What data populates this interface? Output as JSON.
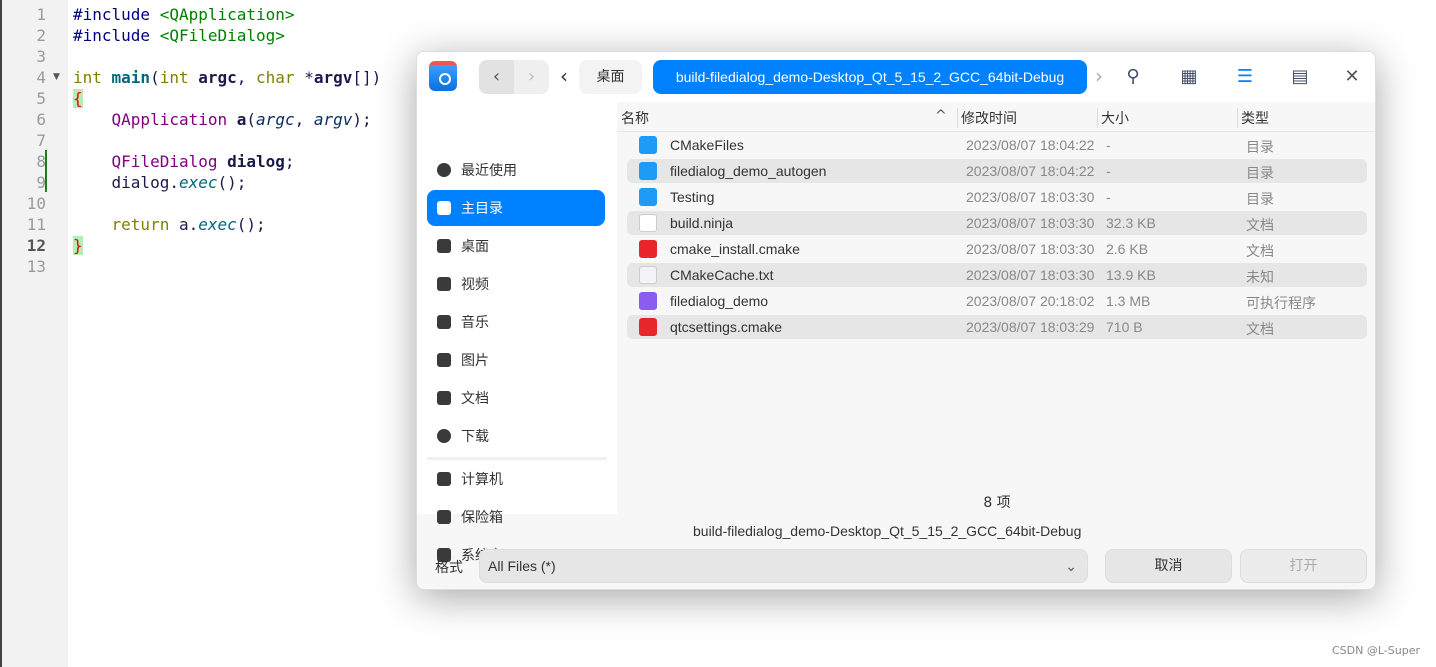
{
  "editor": {
    "line_numbers": [
      "1",
      "2",
      "3",
      "4",
      "5",
      "6",
      "7",
      "8",
      "9",
      "10",
      "11",
      "12",
      "13"
    ],
    "current_line": "12",
    "lines": [
      [
        [
          "pp",
          "#include "
        ],
        [
          "str",
          "<QApplication>"
        ]
      ],
      [
        [
          "pp",
          "#include "
        ],
        [
          "str",
          "<QFileDialog>"
        ]
      ],
      [],
      [
        [
          "kw",
          "int "
        ],
        [
          "fn",
          "main"
        ],
        [
          "",
          "("
        ],
        [
          "kw",
          "int "
        ],
        [
          "bold",
          "argc"
        ],
        [
          "",
          ", "
        ],
        [
          "kw",
          "char "
        ],
        [
          "",
          "*"
        ],
        [
          "bold",
          "argv"
        ],
        [
          "",
          "[])"
        ]
      ],
      [
        [
          "br",
          "{"
        ]
      ],
      [
        [
          "",
          "    "
        ],
        [
          "ty",
          "QApplication "
        ],
        [
          "bold",
          "a"
        ],
        [
          "",
          "("
        ],
        [
          "it",
          "argc"
        ],
        [
          "",
          ", "
        ],
        [
          "it",
          "argv"
        ],
        [
          "",
          ");"
        ]
      ],
      [],
      [
        [
          "",
          "    "
        ],
        [
          "ty",
          "QFileDialog "
        ],
        [
          "bold",
          "dialog"
        ],
        [
          "",
          ";"
        ]
      ],
      [
        [
          "",
          "    dialog."
        ],
        [
          "mt",
          "exec"
        ],
        [
          "",
          "();"
        ]
      ],
      [],
      [
        [
          "",
          "    "
        ],
        [
          "kw",
          "return "
        ],
        [
          "",
          "a."
        ],
        [
          "mt",
          "exec"
        ],
        [
          "",
          "();"
        ]
      ],
      [
        [
          "br",
          "}"
        ]
      ],
      []
    ]
  },
  "dialog": {
    "breadcrumb": [
      "桌面",
      "build-filedialog_demo-Desktop_Qt_5_15_2_GCC_64bit-Debug"
    ],
    "accent": "#0081ff",
    "sidebar": [
      {
        "label": "最近使用",
        "icon": "clock-icon"
      },
      {
        "label": "主目录",
        "icon": "home-icon",
        "active": true
      },
      {
        "label": "桌面",
        "icon": "desktop-icon"
      },
      {
        "label": "视频",
        "icon": "video-icon"
      },
      {
        "label": "音乐",
        "icon": "music-icon"
      },
      {
        "label": "图片",
        "icon": "picture-icon"
      },
      {
        "label": "文档",
        "icon": "document-icon"
      },
      {
        "label": "下载",
        "icon": "download-icon"
      },
      {
        "label": "计算机",
        "icon": "computer-icon"
      },
      {
        "label": "保险箱",
        "icon": "vault-icon"
      },
      {
        "label": "系统盘",
        "icon": "disk-icon"
      }
    ],
    "columns": [
      "名称",
      "修改时间",
      "大小",
      "类型"
    ],
    "files": [
      {
        "name": "CMakeFiles",
        "date": "2023/08/07 18:04:22",
        "size": "-",
        "type": "目录",
        "icon": "folder"
      },
      {
        "name": "filedialog_demo_autogen",
        "date": "2023/08/07 18:04:22",
        "size": "-",
        "type": "目录",
        "icon": "folder"
      },
      {
        "name": "Testing",
        "date": "2023/08/07 18:03:30",
        "size": "-",
        "type": "目录",
        "icon": "folder"
      },
      {
        "name": "build.ninja",
        "date": "2023/08/07 18:03:30",
        "size": "32.3 KB",
        "type": "文档",
        "icon": "doc"
      },
      {
        "name": "cmake_install.cmake",
        "date": "2023/08/07 18:03:30",
        "size": "2.6 KB",
        "type": "文档",
        "icon": "cm"
      },
      {
        "name": "CMakeCache.txt",
        "date": "2023/08/07 18:03:30",
        "size": "13.9 KB",
        "type": "未知",
        "icon": "txt"
      },
      {
        "name": "filedialog_demo",
        "date": "2023/08/07 20:18:02",
        "size": "1.3 MB",
        "type": "可执行程序",
        "icon": "exe"
      },
      {
        "name": "qtcsettings.cmake",
        "date": "2023/08/07 18:03:29",
        "size": "710 B",
        "type": "文档",
        "icon": "cm"
      }
    ],
    "item_count": "8 项",
    "current_path": "build-filedialog_demo-Desktop_Qt_5_15_2_GCC_64bit-Debug",
    "format_label": "格式",
    "filter": "All Files (*)",
    "cancel": "取消",
    "open": "打开"
  },
  "watermark": "CSDN @L-Super"
}
